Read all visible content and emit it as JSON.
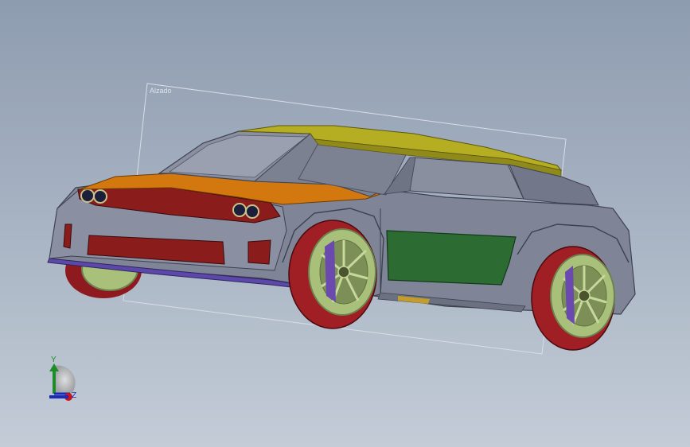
{
  "viewport": {
    "background_top": "#8e9cb0",
    "background_bottom": "#c3ccd7"
  },
  "plane": {
    "label": "Alzado",
    "line_color": "#d9dee6"
  },
  "model": {
    "body_color": "#7f8596",
    "hood_color": "#d2780e",
    "roof_color": "#b5ad22",
    "door_color": "#2c6b32",
    "accent_color": "#8a1c1c",
    "tire_color": "#a01f25",
    "rim_color": "#a8c07a",
    "brake_color": "#6b4ab0"
  },
  "triad": {
    "y_label": "Y",
    "z_label": "Z",
    "x_color": "#c8141c",
    "y_color": "#1f8c2a",
    "z_color": "#1a2bb8"
  }
}
